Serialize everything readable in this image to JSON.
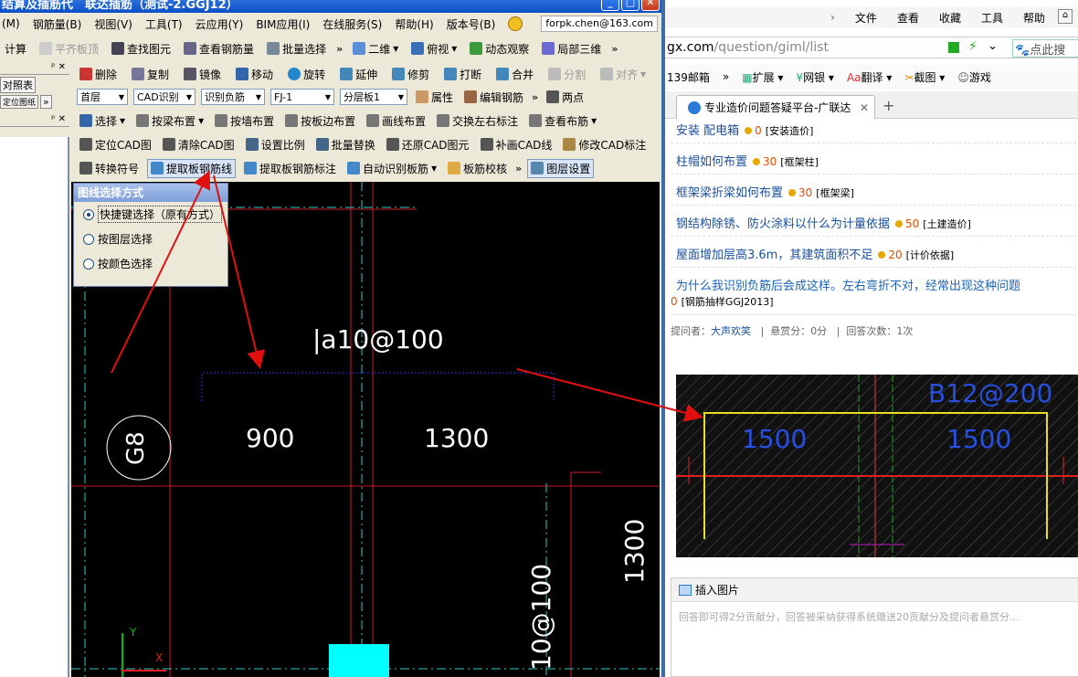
{
  "app": {
    "title": "结算及插筋代　联达插筋（测试-2.GGJ12）",
    "menu": [
      "钢筋量(B)",
      "视图(V)",
      "工具(T)",
      "云应用(Y)",
      "BIM应用(I)",
      "在线服务(S)",
      "帮助(H)",
      "版本号(B)"
    ],
    "menu_first": "(M)",
    "user_email": "forpk.chen@163.com",
    "toolbar1": {
      "calc": "计算",
      "flush": "平齐板顶",
      "find": "查找图元",
      "view_rebar": "查看钢筋量",
      "batch": "批量选择",
      "mode": "二维",
      "view": "俯视",
      "dynamic": "动态观察",
      "local3d": "局部三维"
    },
    "toolbar2": [
      "删除",
      "复制",
      "镜像",
      "移动",
      "旋转",
      "延伸",
      "修剪",
      "打断",
      "合并",
      "分割",
      "对齐"
    ],
    "toolbar3": {
      "floor": "首层",
      "cad": "CAD识别",
      "identify": "识别负筋",
      "code": "FJ-1",
      "layer": "分层板1",
      "prop": "属性",
      "edit": "编辑钢筋",
      "twopoint": "两点"
    },
    "toolbar4": [
      "选择",
      "按梁布置",
      "按墙布置",
      "按板边布置",
      "画线布置",
      "交换左右标注",
      "查看布筋"
    ],
    "toolbar5": [
      "定位CAD图",
      "清除CAD图",
      "设置比例",
      "批量替换",
      "还原CAD图元",
      "补画CAD线",
      "修改CAD标注"
    ],
    "toolbar6": [
      "转换符号",
      "提取板钢筋线",
      "提取板钢筋标注",
      "自动识别板筋",
      "板筋校核",
      "图层设置"
    ],
    "dock": {
      "item1": "对照表",
      "item2": "定位图纸",
      "pin": "»"
    },
    "line_panel": {
      "title": "图线选择方式",
      "options": [
        "快捷键选择（原有方式）",
        "按图层选择",
        "按颜色选择"
      ],
      "selected": 0
    },
    "cad": {
      "label_top": "|a10@100",
      "dim_left": "900",
      "dim_right": "1300",
      "axis_bubble": "G8",
      "dim_vertical": "1300",
      "label_vertical": "10@100",
      "axis_y": "Y",
      "axis_x": "X"
    }
  },
  "browser": {
    "menu": [
      "文件",
      "查看",
      "收藏",
      "工具",
      "帮助"
    ],
    "url_host": "gx.com",
    "url_path": "/question/giml/list",
    "search_placeholder": "点此搜",
    "favorites": [
      "139邮箱",
      "扩展",
      "网银",
      "翻译",
      "截图",
      "游戏"
    ],
    "tab_title": "专业造价问题答疑平台-广联达",
    "questions": [
      {
        "title": "安装 配电箱",
        "score": "0",
        "category": "[安装造价]"
      },
      {
        "title": "柱帽如何布置",
        "score": "30",
        "category": "[框架柱]"
      },
      {
        "title": "框架梁折梁如何布置",
        "score": "30",
        "category": "[框架梁]"
      },
      {
        "title": "钢结构除锈、防火涂料以什么为计量依据",
        "score": "50",
        "category": "[土建造价]"
      },
      {
        "title": "屋面增加层高3.6m，其建筑面积不足",
        "score": "20",
        "category": "[计价依据]"
      }
    ],
    "current_question": {
      "title": "为什么我识别负筋后会成这样。左右弯折不对，经常出现这种问题",
      "score": "0",
      "category": "[钢筋抽样GGJ2013]",
      "asker_label": "提问者：",
      "asker": "大声欢笑",
      "reward": "悬赏分：0分",
      "answers": "回答次数：1次"
    },
    "thumb": {
      "label": "B12@200",
      "dim_left": "1500",
      "dim_right": "1500"
    },
    "answer": {
      "insert_image": "插入图片",
      "placeholder": "回答即可得2分贡献分，回答被采纳获得系统赠送20贡献分及提问者悬赏分..."
    }
  }
}
